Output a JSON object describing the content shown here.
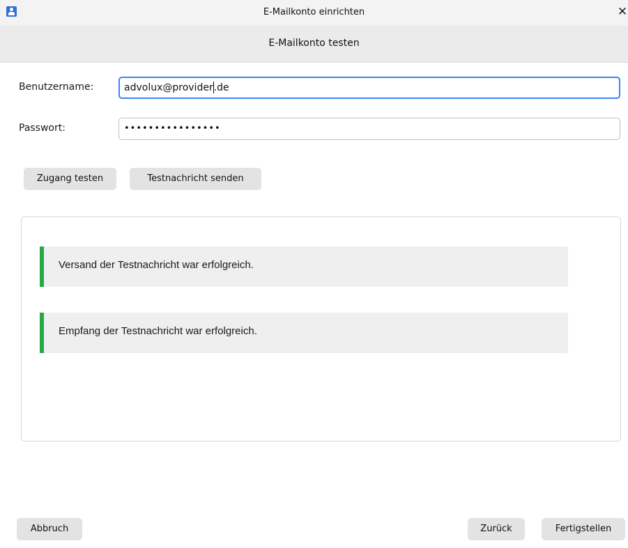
{
  "window": {
    "title": "E-Mailkonto einrichten",
    "close_glyph": "✕",
    "icon": "app-user-icon"
  },
  "page": {
    "heading": "E-Mailkonto testen"
  },
  "form": {
    "username_label": "Benutzername:",
    "username_value_before_caret": "advolux@provider",
    "username_value_after_caret": ".de",
    "password_label": "Passwort:",
    "password_value": "••••••••••••••••"
  },
  "actions": {
    "test_access_label": "Zugang testen",
    "send_test_label": "Testnachricht senden"
  },
  "results": {
    "messages": [
      {
        "text": "Versand der Testnachricht war erfolgreich.",
        "status_color": "#28a745"
      },
      {
        "text": "Empfang der Testnachricht war erfolgreich.",
        "status_color": "#28a745"
      }
    ]
  },
  "footer": {
    "cancel_label": "Abbruch",
    "back_label": "Zurück",
    "finish_label": "Fertigstellen"
  },
  "colors": {
    "accent": "#3b82f6",
    "success": "#28a745"
  }
}
